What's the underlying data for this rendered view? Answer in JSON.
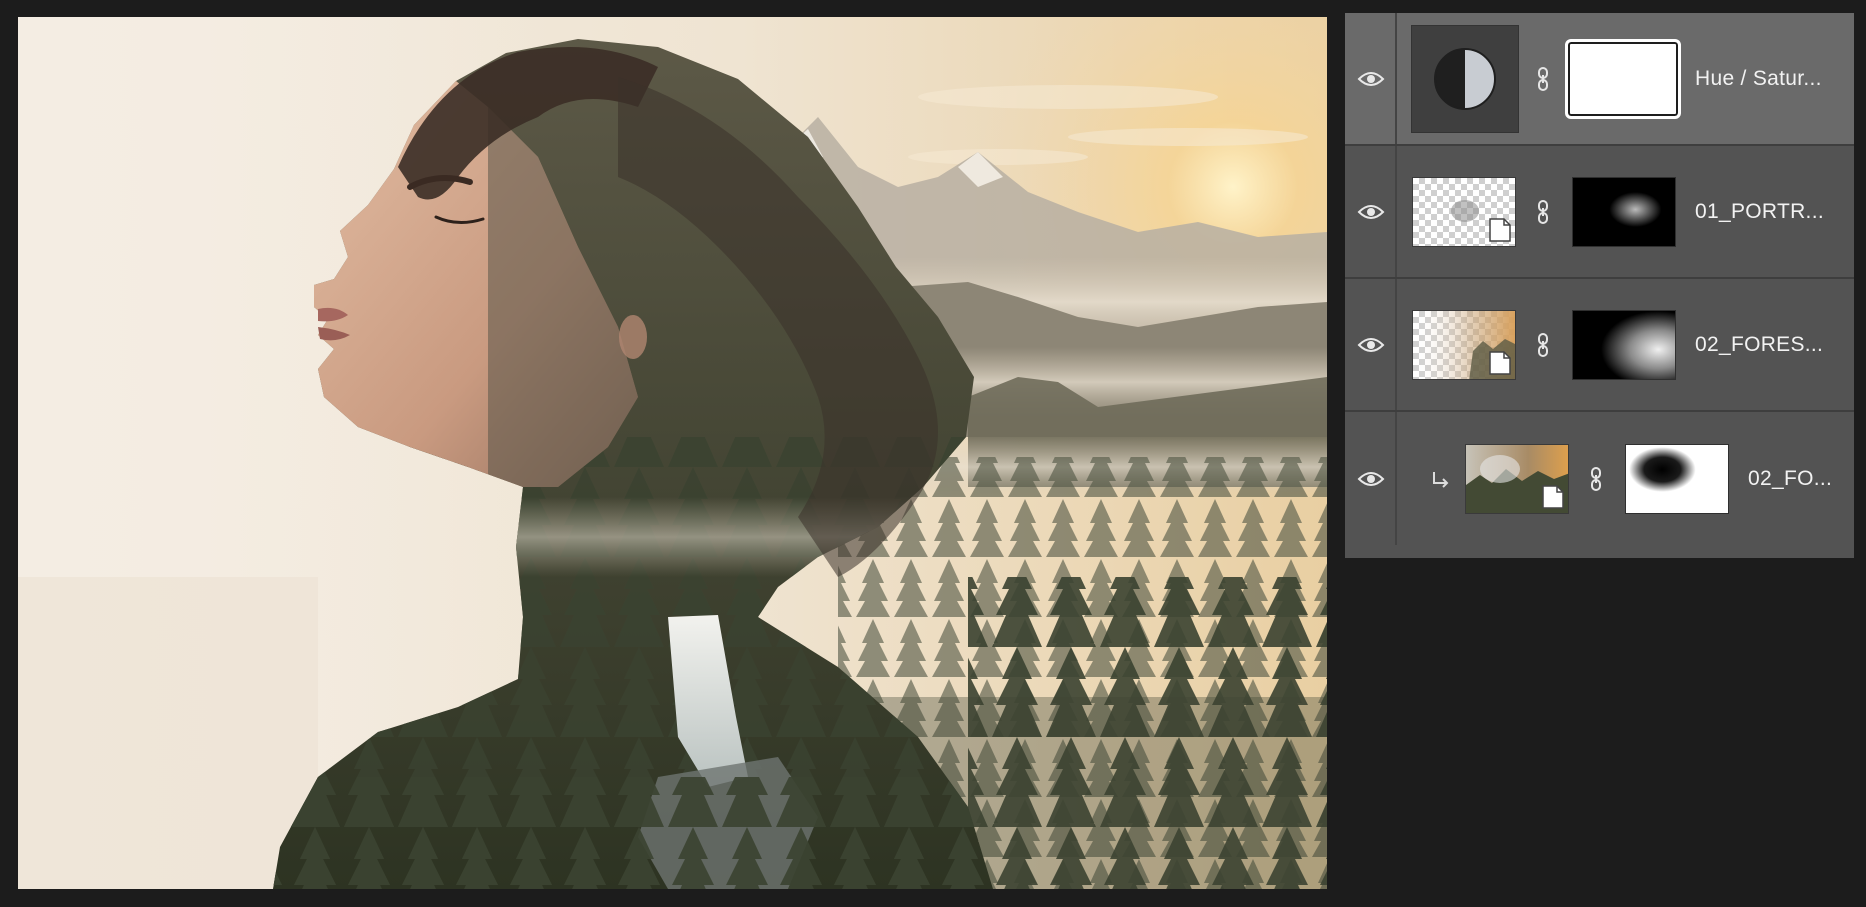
{
  "canvas": {
    "alt": "double exposure artwork: portrait silhouette blended with mountain forest landscape"
  },
  "layers_panel": {
    "layers": [
      {
        "name": "Hue / Satur...",
        "type": "adjustment",
        "visible": true,
        "selected": true,
        "clipped": false
      },
      {
        "name": "01_PORTR...",
        "type": "smart-object",
        "visible": true,
        "selected": false,
        "clipped": false
      },
      {
        "name": "02_FORES...",
        "type": "smart-object",
        "visible": true,
        "selected": false,
        "clipped": false
      },
      {
        "name": "02_FO...",
        "type": "smart-object",
        "visible": true,
        "selected": false,
        "clipped": true
      }
    ]
  },
  "icons": {
    "eye": "eye-icon",
    "link": "link-icon",
    "clip": "clip-arrow-icon",
    "adjustment": "hue-saturation-icon",
    "smart_object": "smart-object-badge-icon"
  },
  "colors": {
    "app_bg": "#1c1c1c",
    "panel_bg": "#535353",
    "selected_row": "#6a6a6a",
    "canvas_bg": "#f3ebdf",
    "sun": "#ffd98a"
  }
}
